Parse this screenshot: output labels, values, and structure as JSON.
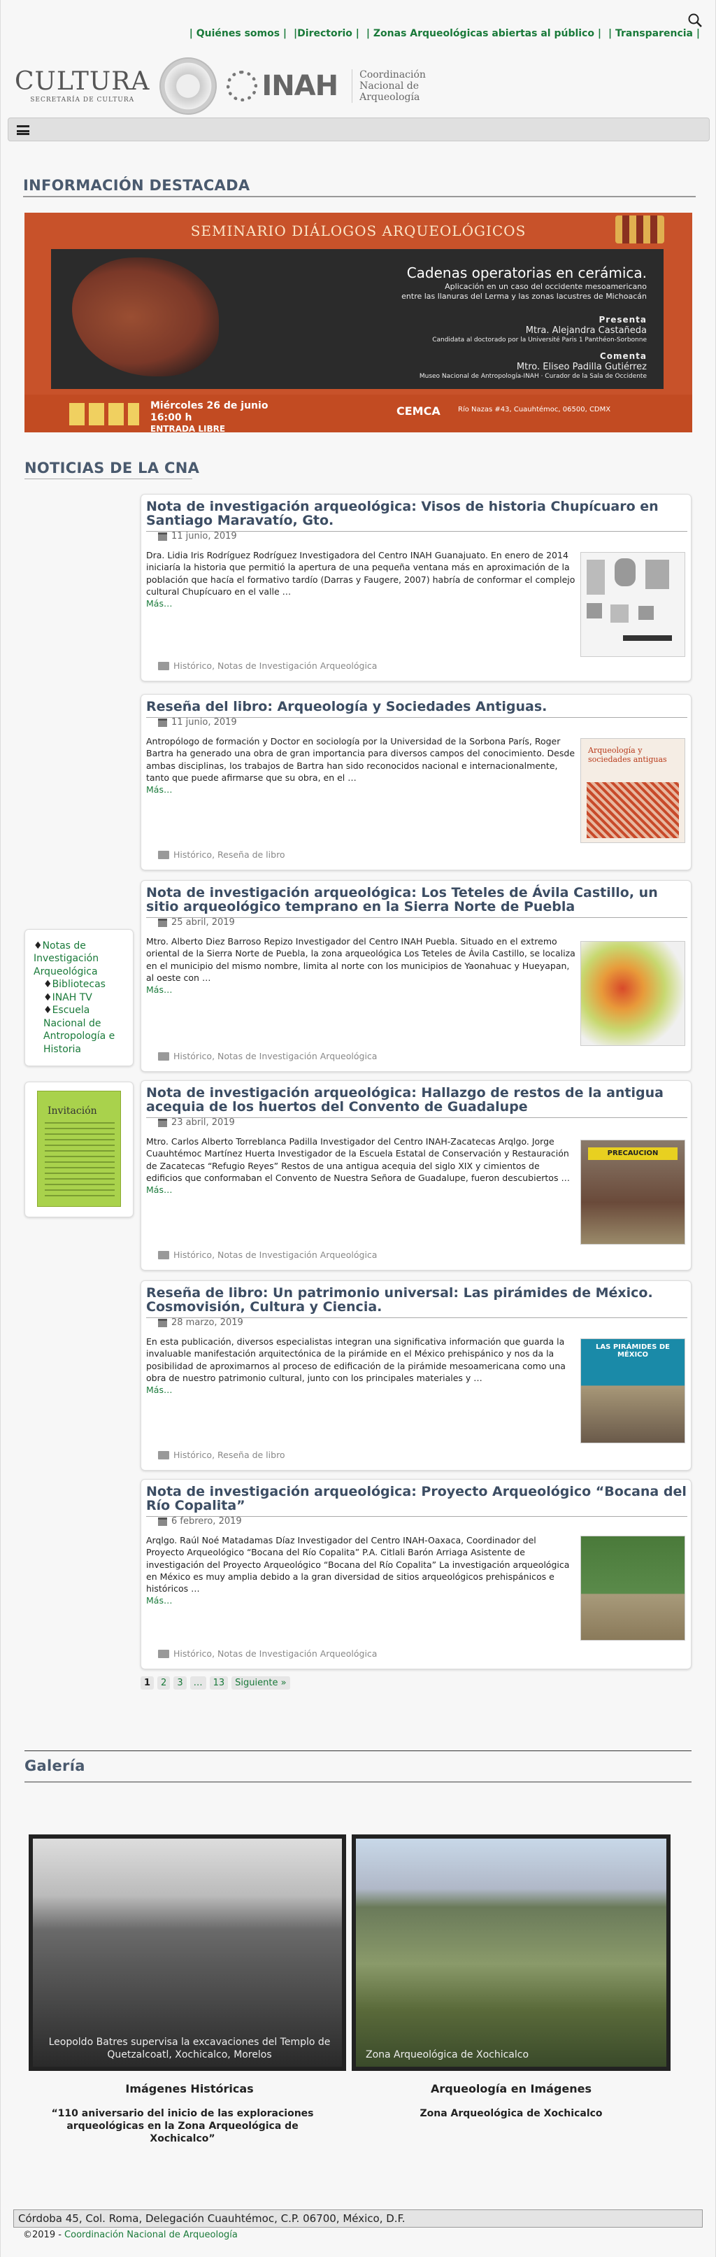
{
  "top_nav": {
    "items": [
      "| Quiénes somos |",
      "|Directorio |",
      "| Zonas Arqueológicas abiertas al público |",
      "| Transparencia |"
    ]
  },
  "logos": {
    "cultura": "CULTURA",
    "cultura_sub": "SECRETARÍA DE CULTURA",
    "inah": "INAH",
    "cna_lines": [
      "Coordinación",
      "Nacional de",
      "Arqueología"
    ]
  },
  "sections": {
    "featured": "INFORMACIÓN DESTACADA",
    "news": "NOTICIAS DE LA CNA",
    "gallery": "Galería"
  },
  "banner": {
    "title": "SEMINARIO DIÁLOGOS ARQUEOLÓGICOS",
    "headline": "Cadenas operatorias en cerámica.",
    "subline1": "Aplicación en un caso del occidente mesoamericano",
    "subline2": "entre las llanuras del Lerma y las zonas lacustres de Michoacán",
    "presenta_label": "Presenta",
    "presenta_name": "Mtra. Alejandra Castañeda",
    "presenta_info": "Candidata al doctorado por la Université Paris 1 Panthéon-Sorbonne",
    "comenta_label": "Comenta",
    "comenta_name": "Mtro. Eliseo Padilla Gutiérrez",
    "comenta_info": "Museo Nacional de Antropología-INAH · Curador de la Sala de Occidente",
    "date_line1": "Miércoles 26 de junio",
    "date_line2": "16:00 h",
    "date_line3": "ENTRADA LIBRE",
    "venue": "CEMCA",
    "address": "Río Nazas #43, Cuauhtémoc, 06500, CDMX"
  },
  "sidebar": {
    "links": [
      "Notas de Investigación Arqueológica",
      "Bibliotecas",
      "INAH TV",
      "Escuela Nacional de Antropología e Historia"
    ],
    "invite_title": "Invitación"
  },
  "articles": [
    {
      "title": "Nota de investigación arqueológica: Visos de historia Chupícuaro en Santiago Maravatío, Gto.",
      "date": "11 junio, 2019",
      "body": "Dra. Lidia Iris Rodríguez Rodríguez Investigadora del Centro INAH Guanajuato. En enero de 2014 iniciaría la historia que permitió la apertura de una pequeña ventana más en aproximación de la población que hacía el formativo tardío (Darras y Faugere, 2007) habría de conformar el complejo cultural Chupícuaro en el valle …",
      "more": "Más…",
      "categories": "Histórico, Notas de Investigación Arqueológica"
    },
    {
      "title": "Reseña del libro: Arqueología y Sociedades Antiguas.",
      "date": "11 junio, 2019",
      "body": "Antropólogo de formación y Doctor en sociología por la Universidad de la Sorbona París, Roger Bartra ha generado una obra de gran importancia para diversos campos del conocimiento. Desde ambas disciplinas, los trabajos de Bartra han sido reconocidos nacional e internacionalmente, tanto que puede afirmarse que su obra, en el …",
      "more": "Más…",
      "categories": "Histórico, Reseña de libro",
      "img_text": "Arqueología y sociedades antiguas"
    },
    {
      "title": "Nota de investigación arqueológica: Los Teteles de Ávila Castillo, un sitio arqueológico temprano en la Sierra Norte de Puebla",
      "date": "25 abril, 2019",
      "body": "Mtro. Alberto Diez Barroso Repizo Investigador del Centro INAH Puebla. Situado en el extremo oriental de la Sierra Norte de Puebla, la zona arqueológica Los Teteles de Ávila Castillo, se localiza en el municipio del mismo nombre, limita al norte con los municipios de Yaonahuac y Hueyapan, al oeste con …",
      "more": "Más…",
      "categories": "Histórico, Notas de Investigación Arqueológica"
    },
    {
      "title": "Nota de investigación arqueológica: Hallazgo de restos de la antigua acequia de los huertos del Convento de Guadalupe",
      "date": "23 abril, 2019",
      "body": "Mtro. Carlos Alberto Torreblanca Padilla Investigador del Centro INAH-Zacatecas Arqlgo. Jorge Cuauhtémoc Martínez Huerta Investigador de la Escuela Estatal de Conservación y Restauración de Zacatecas “Refugio Reyes” Restos de una antigua acequia del siglo XIX y cimientos de edificios que conformaban el Convento de Nuestra Señora de Guadalupe, fueron descubiertos …",
      "more": "Más…",
      "categories": "Histórico, Notas de Investigación Arqueológica",
      "img_text": "PRECAUCION"
    },
    {
      "title": "Reseña de libro: Un patrimonio universal: Las pirámides de México. Cosmovisión, Cultura y Ciencia.",
      "date": "28 marzo, 2019",
      "body": "En esta publicación, diversos especialistas integran una significativa información que guarda la invaluable manifestación arquitectónica de la pirámide en el México prehispánico y nos da la posibilidad de aproximarnos al proceso de edificación de la pirámide mesoamericana como una obra de nuestro patrimonio cultural, junto con los principales materiales y …",
      "more": "Más…",
      "categories": "Histórico, Reseña de libro",
      "img_text": "LAS PIRÁMIDES DE MÉXICO"
    },
    {
      "title": "Nota de investigación arqueológica: Proyecto Arqueológico “Bocana del Río Copalita”",
      "date": "6 febrero, 2019",
      "body": "Arqlgo. Raúl Noé Matadamas Díaz Investigador del Centro INAH-Oaxaca, Coordinador del Proyecto Arqueológico “Bocana del Río Copalita” P.A. Citlali Barón Arriaga Asistente de investigación del Proyecto Arqueológico “Bocana del Río Copalita” La investigación arqueológica en México es muy amplia debido a la gran diversidad de sitios arqueológicos prehispánicos e históricos …",
      "more": "Más…",
      "categories": "Histórico, Notas de Investigación Arqueológica"
    }
  ],
  "pager": {
    "pages": [
      "1",
      "2",
      "3",
      "…",
      "13"
    ],
    "next": "Siguiente »"
  },
  "gallery": [
    {
      "caption": "Leopoldo Batres supervisa la excavaciones del Templo de Quetzalcoatl, Xochicalco, Morelos",
      "title": "Imágenes Históricas",
      "subtitle": "“110 aniversario del inicio de las exploraciones arqueológicas en la Zona Arqueológica de Xochicalco”"
    },
    {
      "caption": "Zona Arqueológica de Xochicalco",
      "title": "Arqueología en Imágenes",
      "subtitle": "Zona Arqueológica de Xochicalco"
    }
  ],
  "footer": {
    "address": "Córdoba 45, Col. Roma, Delegación Cuauhtémoc, C.P. 06700, México, D.F.",
    "copyright_prefix": "©2019 - ",
    "copyright_link": "Coordinación Nacional de Arqueología"
  }
}
